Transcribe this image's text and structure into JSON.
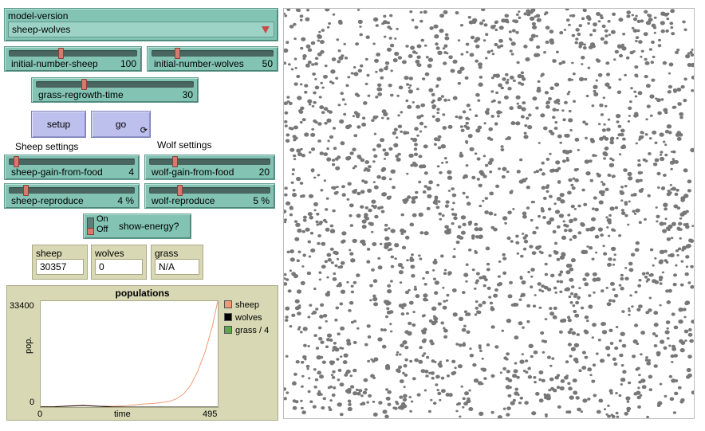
{
  "chooser": {
    "label": "model-version",
    "value": "sheep-wolves"
  },
  "sliders": {
    "initial_number_sheep": {
      "name": "initial-number-sheep",
      "value": "100",
      "fraction": 0.4
    },
    "initial_number_wolves": {
      "name": "initial-number-wolves",
      "value": "50",
      "fraction": 0.2
    },
    "grass_regrowth_time": {
      "name": "grass-regrowth-time",
      "value": "30",
      "fraction": 0.3
    },
    "sheep_gain_from_food": {
      "name": "sheep-gain-from-food",
      "value": "4",
      "fraction": 0.04
    },
    "wolf_gain_from_food": {
      "name": "wolf-gain-from-food",
      "value": "20",
      "fraction": 0.2
    },
    "sheep_reproduce": {
      "name": "sheep-reproduce",
      "value": "4 %",
      "fraction": 0.12
    },
    "wolf_reproduce": {
      "name": "wolf-reproduce",
      "value": "5 %",
      "fraction": 0.24
    }
  },
  "buttons": {
    "setup": "setup",
    "go": "go",
    "go_forever_icon": "⟳",
    "go_icon_name": "forever-icon"
  },
  "sections": {
    "sheep": "Sheep settings",
    "wolf": "Wolf settings"
  },
  "switch": {
    "on_label": "On",
    "off_label": "Off",
    "name": "show-energy?",
    "state": "off"
  },
  "monitors": {
    "sheep": {
      "label": "sheep",
      "value": "30357"
    },
    "wolves": {
      "label": "wolves",
      "value": "0"
    },
    "grass": {
      "label": "grass",
      "value": "N/A"
    }
  },
  "plot": {
    "title": "populations",
    "ymax": "33400",
    "ymin": "0",
    "ylabel": "pop.",
    "xmin": "0",
    "xlabel": "time",
    "xmax": "495",
    "legend": [
      {
        "name": "sheep",
        "color": "#f29b73"
      },
      {
        "name": "wolves",
        "color": "#000000"
      },
      {
        "name": "grass / 4",
        "color": "#5ba84c"
      }
    ]
  },
  "colors": {
    "widget": "#82c3b4",
    "button": "#bdbfec",
    "monitor": "#d8d8b4",
    "sheep_line": "#f29b73",
    "wolves_line": "#000000",
    "world_background": "#ffffff",
    "agent": "#777777"
  },
  "chart_data": {
    "type": "line",
    "title": "populations",
    "xlabel": "time",
    "ylabel": "pop.",
    "xlim": [
      0,
      495
    ],
    "ylim": [
      0,
      33400
    ],
    "series": [
      {
        "name": "sheep",
        "x": [
          0,
          40,
          80,
          120,
          160,
          200,
          240,
          280,
          320,
          360,
          380,
          400,
          420,
          440,
          460,
          480,
          495
        ],
        "y": [
          100,
          150,
          400,
          600,
          300,
          250,
          400,
          900,
          1200,
          1800,
          2600,
          4200,
          7000,
          11500,
          17500,
          25500,
          33400
        ]
      },
      {
        "name": "wolves",
        "x": [
          0,
          40,
          80,
          120,
          160,
          200,
          240,
          280,
          320,
          360,
          400,
          440,
          495
        ],
        "y": [
          50,
          100,
          300,
          500,
          250,
          50,
          0,
          0,
          0,
          0,
          0,
          0,
          0
        ]
      },
      {
        "name": "grass / 4",
        "x": [],
        "y": []
      }
    ]
  }
}
